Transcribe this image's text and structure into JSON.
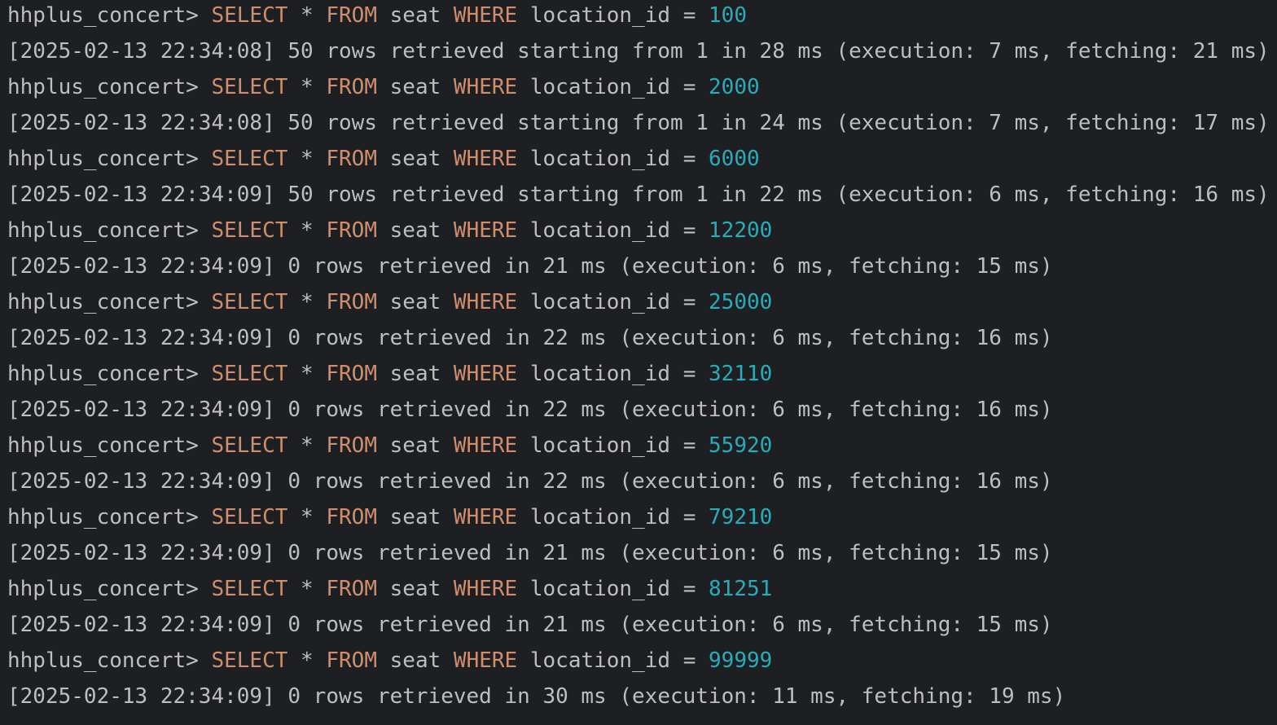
{
  "console": {
    "prompt": "hhplus_concert>",
    "colors": {
      "background": "#1e1f22",
      "text": "#bcbec4",
      "keyword": "#cf8e6d",
      "number": "#2aacb8"
    },
    "entries": [
      {
        "query": {
          "kw_select": "SELECT",
          "star": "*",
          "kw_from": "FROM",
          "table": "seat",
          "kw_where": "WHERE",
          "column": "location_id",
          "op": "=",
          "value": "100"
        },
        "result": "[2025-02-13 22:34:08] 50 rows retrieved starting from 1 in 28 ms (execution: 7 ms, fetching: 21 ms)"
      },
      {
        "query": {
          "kw_select": "SELECT",
          "star": "*",
          "kw_from": "FROM",
          "table": "seat",
          "kw_where": "WHERE",
          "column": "location_id",
          "op": "=",
          "value": "2000"
        },
        "result": "[2025-02-13 22:34:08] 50 rows retrieved starting from 1 in 24 ms (execution: 7 ms, fetching: 17 ms)"
      },
      {
        "query": {
          "kw_select": "SELECT",
          "star": "*",
          "kw_from": "FROM",
          "table": "seat",
          "kw_where": "WHERE",
          "column": "location_id",
          "op": "=",
          "value": "6000"
        },
        "result": "[2025-02-13 22:34:09] 50 rows retrieved starting from 1 in 22 ms (execution: 6 ms, fetching: 16 ms)"
      },
      {
        "query": {
          "kw_select": "SELECT",
          "star": "*",
          "kw_from": "FROM",
          "table": "seat",
          "kw_where": "WHERE",
          "column": "location_id",
          "op": "=",
          "value": "12200"
        },
        "result": "[2025-02-13 22:34:09] 0 rows retrieved in 21 ms (execution: 6 ms, fetching: 15 ms)"
      },
      {
        "query": {
          "kw_select": "SELECT",
          "star": "*",
          "kw_from": "FROM",
          "table": "seat",
          "kw_where": "WHERE",
          "column": "location_id",
          "op": "=",
          "value": "25000"
        },
        "result": "[2025-02-13 22:34:09] 0 rows retrieved in 22 ms (execution: 6 ms, fetching: 16 ms)"
      },
      {
        "query": {
          "kw_select": "SELECT",
          "star": "*",
          "kw_from": "FROM",
          "table": "seat",
          "kw_where": "WHERE",
          "column": "location_id",
          "op": "=",
          "value": "32110"
        },
        "result": "[2025-02-13 22:34:09] 0 rows retrieved in 22 ms (execution: 6 ms, fetching: 16 ms)"
      },
      {
        "query": {
          "kw_select": "SELECT",
          "star": "*",
          "kw_from": "FROM",
          "table": "seat",
          "kw_where": "WHERE",
          "column": "location_id",
          "op": "=",
          "value": "55920"
        },
        "result": "[2025-02-13 22:34:09] 0 rows retrieved in 22 ms (execution: 6 ms, fetching: 16 ms)"
      },
      {
        "query": {
          "kw_select": "SELECT",
          "star": "*",
          "kw_from": "FROM",
          "table": "seat",
          "kw_where": "WHERE",
          "column": "location_id",
          "op": "=",
          "value": "79210"
        },
        "result": "[2025-02-13 22:34:09] 0 rows retrieved in 21 ms (execution: 6 ms, fetching: 15 ms)"
      },
      {
        "query": {
          "kw_select": "SELECT",
          "star": "*",
          "kw_from": "FROM",
          "table": "seat",
          "kw_where": "WHERE",
          "column": "location_id",
          "op": "=",
          "value": "81251"
        },
        "result": "[2025-02-13 22:34:09] 0 rows retrieved in 21 ms (execution: 6 ms, fetching: 15 ms)"
      },
      {
        "query": {
          "kw_select": "SELECT",
          "star": "*",
          "kw_from": "FROM",
          "table": "seat",
          "kw_where": "WHERE",
          "column": "location_id",
          "op": "=",
          "value": "99999"
        },
        "result": "[2025-02-13 22:34:09] 0 rows retrieved in 30 ms (execution: 11 ms, fetching: 19 ms)"
      }
    ]
  }
}
